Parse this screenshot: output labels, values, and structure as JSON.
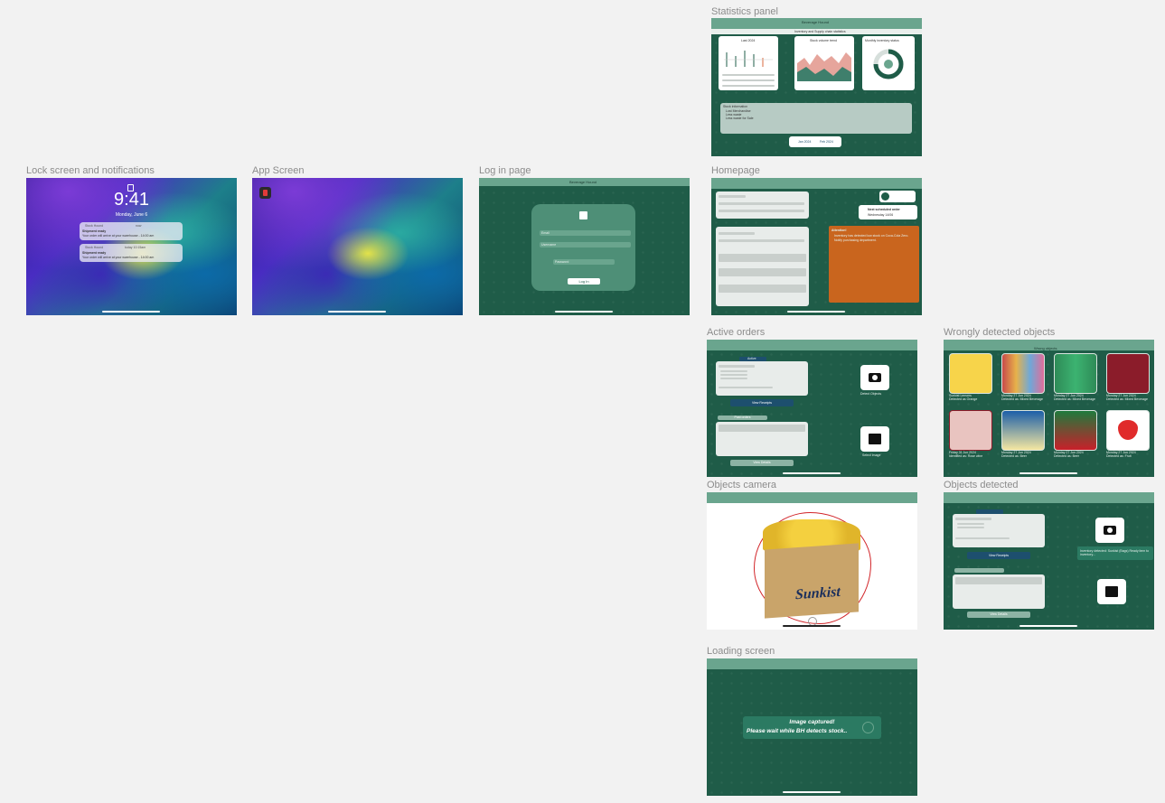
{
  "frames": {
    "lock_screen": {
      "label": "Lock screen and notifications",
      "time": "9:41",
      "date": "Monday, June 6",
      "notifications": [
        {
          "app": "Stock Hound",
          "when": "now",
          "title": "Shipment ready",
          "body": "Your order will arrive at your warehouse - 14:00 am"
        },
        {
          "app": "Stock Hound",
          "when": "today 10:15am",
          "title": "Shipment ready",
          "body": "Your order will arrive at your warehouse - 14:00 am"
        }
      ]
    },
    "app_screen": {
      "label": "App Screen"
    },
    "login": {
      "label": "Log in page",
      "title": "Beverage Hound",
      "email_placeholder": "Email",
      "username_placeholder": "Username",
      "password_placeholder": "Password",
      "login_button": "Log In"
    },
    "statistics": {
      "label": "Statistics panel",
      "title": "Beverage Hound",
      "subtitle": "Inventory and Supply chain statistics",
      "card1_title": "Last 2024",
      "card2_title": "Stock volume trend",
      "card3_title": "Monthly inventory status",
      "notes_title": "Stock information",
      "notes": [
        "Lost Merchandise",
        "Less waste",
        "Less waste for Sale"
      ],
      "pager": [
        "Jan 2024",
        "Feb 2024"
      ]
    },
    "homepage": {
      "label": "Homepage",
      "alert_title": "Attention!",
      "alert_lines": [
        "Inventory has detected low stock on Coca-Cola Zero.",
        "Notify purchasing department."
      ],
      "order_title": "Next scheduled order",
      "order_date": "Wednesday 14/06"
    },
    "active_orders": {
      "label": "Active orders",
      "tab": "Active",
      "view_receipts": "View Receipts",
      "past_orders": "Past orders",
      "view_details": "View Details",
      "camera_caption": "Detect Objects",
      "gallery_caption": "Select Image"
    },
    "wrong_objects": {
      "label": "Wrongly detected objects",
      "title": "Wrong objects",
      "items": [
        {
          "name": "Sunkist Lemons",
          "note": "Detected as Orange"
        },
        {
          "name": "Monday 27 Jun 2024",
          "note": "Detected as: Mixed Beverage"
        },
        {
          "name": "Monday 27 Jun 2024",
          "note": "Detected as: Mixed Beverage"
        },
        {
          "name": "Monday 27 Jun 2024",
          "note": "Detected as: Mixed Beverage"
        },
        {
          "name": "Friday 31 Jun 2024",
          "note": "Identified as: Rose wine"
        },
        {
          "name": "Monday 27 Jun 2024",
          "note": "Detected as: Beer"
        },
        {
          "name": "Monday 27 Jun 2024",
          "note": "Detected as: Beer"
        },
        {
          "name": "Monday 27 Jun 2024",
          "note": "Detected as: Fruit"
        }
      ]
    },
    "objects_camera": {
      "label": "Objects camera",
      "brand": "Sunkist"
    },
    "objects_detected": {
      "label": "Objects detected",
      "toast": "Inventory detected: Sunkist (Bags) Ready item to inventory...",
      "view_receipts": "View Receipts",
      "view_details": "View Details"
    },
    "loading": {
      "label": "Loading screen",
      "line1": "Image captured!",
      "line2": "Please wait while BH detects stock.."
    }
  },
  "colors": {
    "app_green": "#1f5c48",
    "bar_green": "#6aa58e",
    "alert_orange": "#c9651e",
    "button_blue": "#1d4f6e"
  }
}
